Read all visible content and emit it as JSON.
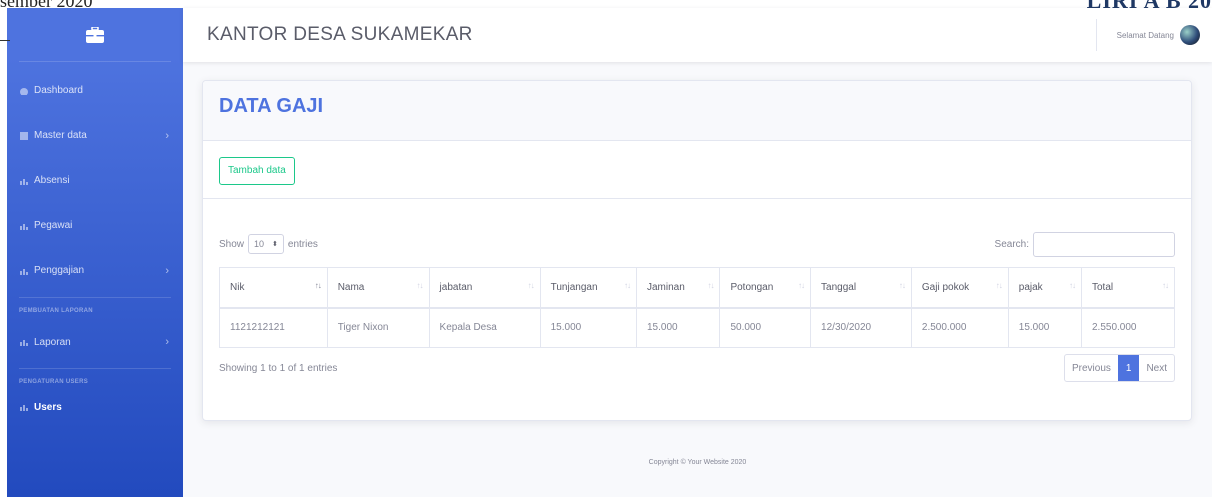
{
  "doc_artifacts": {
    "top_left": "sember 2020",
    "top_right": "LIRI A B 20"
  },
  "sidebar": {
    "brand_icon": "briefcase-icon",
    "items": [
      {
        "label": "Dashboard",
        "icon": "dashboard-icon",
        "has_chevron": false
      },
      {
        "label": "Master data",
        "icon": "table-icon",
        "has_chevron": true
      },
      {
        "label": "Absensi",
        "icon": "chart-icon",
        "has_chevron": false
      },
      {
        "label": "Pegawai",
        "icon": "chart-icon",
        "has_chevron": false
      },
      {
        "label": "Penggajian",
        "icon": "chart-icon",
        "has_chevron": true
      }
    ],
    "heading_reports": "PEMBUATAN LAPORAN",
    "laporan": {
      "label": "Laporan",
      "icon": "chart-icon"
    },
    "heading_users": "PENGATURAN USERS",
    "users": {
      "label": "Users",
      "icon": "chart-icon"
    }
  },
  "topbar": {
    "title": "KANTOR DESA SUKAMEKAR",
    "greeting": "Selamat Datang"
  },
  "card": {
    "title": "DATA GAJI",
    "add_button": "Tambah data",
    "length": {
      "show": "Show",
      "value": "10",
      "entries": "entries"
    },
    "search": {
      "label": "Search:",
      "value": ""
    },
    "columns": [
      "Nik",
      "Nama",
      "jabatan",
      "Tunjangan",
      "Jaminan",
      "Potongan",
      "Tanggal",
      "Gaji pokok",
      "pajak",
      "Total"
    ],
    "rows": [
      [
        "1121212121",
        "Tiger Nixon",
        "Kepala Desa",
        "15.000",
        "15.000",
        "50.000",
        "12/30/2020",
        "2.500.000",
        "15.000",
        "2.550.000"
      ]
    ],
    "info": "Showing 1 to 1 of 1 entries",
    "pager": {
      "previous": "Previous",
      "current": "1",
      "next": "Next"
    }
  },
  "footer": "Copyright © Your Website 2020",
  "colors": {
    "primary": "#4e73df",
    "success": "#1cc88a",
    "sidebar_dark": "#224abe"
  }
}
